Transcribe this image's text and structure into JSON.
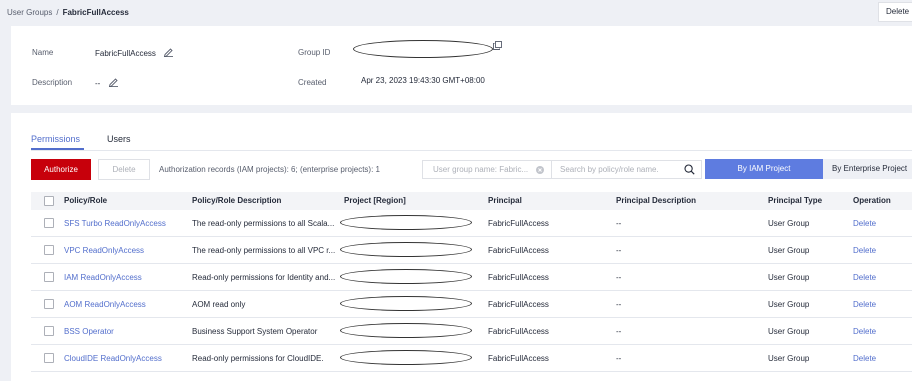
{
  "breadcrumb": {
    "parent": "User Groups",
    "separator": "/",
    "current": "FabricFullAccess"
  },
  "header": {
    "delete_label": "Delete"
  },
  "info": {
    "name_label": "Name",
    "name_value": "FabricFullAccess",
    "group_id_label": "Group ID",
    "description_label": "Description",
    "description_value": "--",
    "created_label": "Created",
    "created_value": "Apr 23, 2023 19:43:30 GMT+08:00"
  },
  "tabs": [
    {
      "label": "Permissions",
      "active": true
    },
    {
      "label": "Users",
      "active": false
    }
  ],
  "toolbar": {
    "authorize_label": "Authorize",
    "delete_label": "Delete",
    "auth_records": "Authorization records (IAM projects): 6; (enterprise projects): 1",
    "filter_value": "User group name: Fabric...",
    "search_placeholder": "Search by policy/role name.",
    "view_iam_label": "By IAM Project",
    "view_enterprise_label": "By Enterprise Project"
  },
  "colors": {
    "brand_red": "#c7000b",
    "link_blue": "#526ecc",
    "segment_blue": "#5e7ce0"
  },
  "table": {
    "columns": [
      "Policy/Role",
      "Policy/Role Description",
      "Project [Region]",
      "Principal",
      "Principal Description",
      "Principal Type",
      "Operation"
    ],
    "rows": [
      {
        "policy": "SFS Turbo ReadOnlyAccess",
        "description": "The read-only permissions to all Scala...",
        "principal": "FabricFullAccess",
        "principal_description": "--",
        "principal_type": "User Group",
        "operation": "Delete"
      },
      {
        "policy": "VPC ReadOnlyAccess",
        "description": "The read-only permissions to all VPC r...",
        "principal": "FabricFullAccess",
        "principal_description": "--",
        "principal_type": "User Group",
        "operation": "Delete"
      },
      {
        "policy": "IAM ReadOnlyAccess",
        "description": "Read-only permissions for Identity and...",
        "principal": "FabricFullAccess",
        "principal_description": "--",
        "principal_type": "User Group",
        "operation": "Delete"
      },
      {
        "policy": "AOM ReadOnlyAccess",
        "description": "AOM read only",
        "principal": "FabricFullAccess",
        "principal_description": "--",
        "principal_type": "User Group",
        "operation": "Delete"
      },
      {
        "policy": "BSS Operator",
        "description": "Business Support System Operator",
        "principal": "FabricFullAccess",
        "principal_description": "--",
        "principal_type": "User Group",
        "operation": "Delete"
      },
      {
        "policy": "CloudIDE ReadOnlyAccess",
        "description": "Read-only permissions for CloudIDE.",
        "principal": "FabricFullAccess",
        "principal_description": "--",
        "principal_type": "User Group",
        "operation": "Delete"
      }
    ]
  }
}
